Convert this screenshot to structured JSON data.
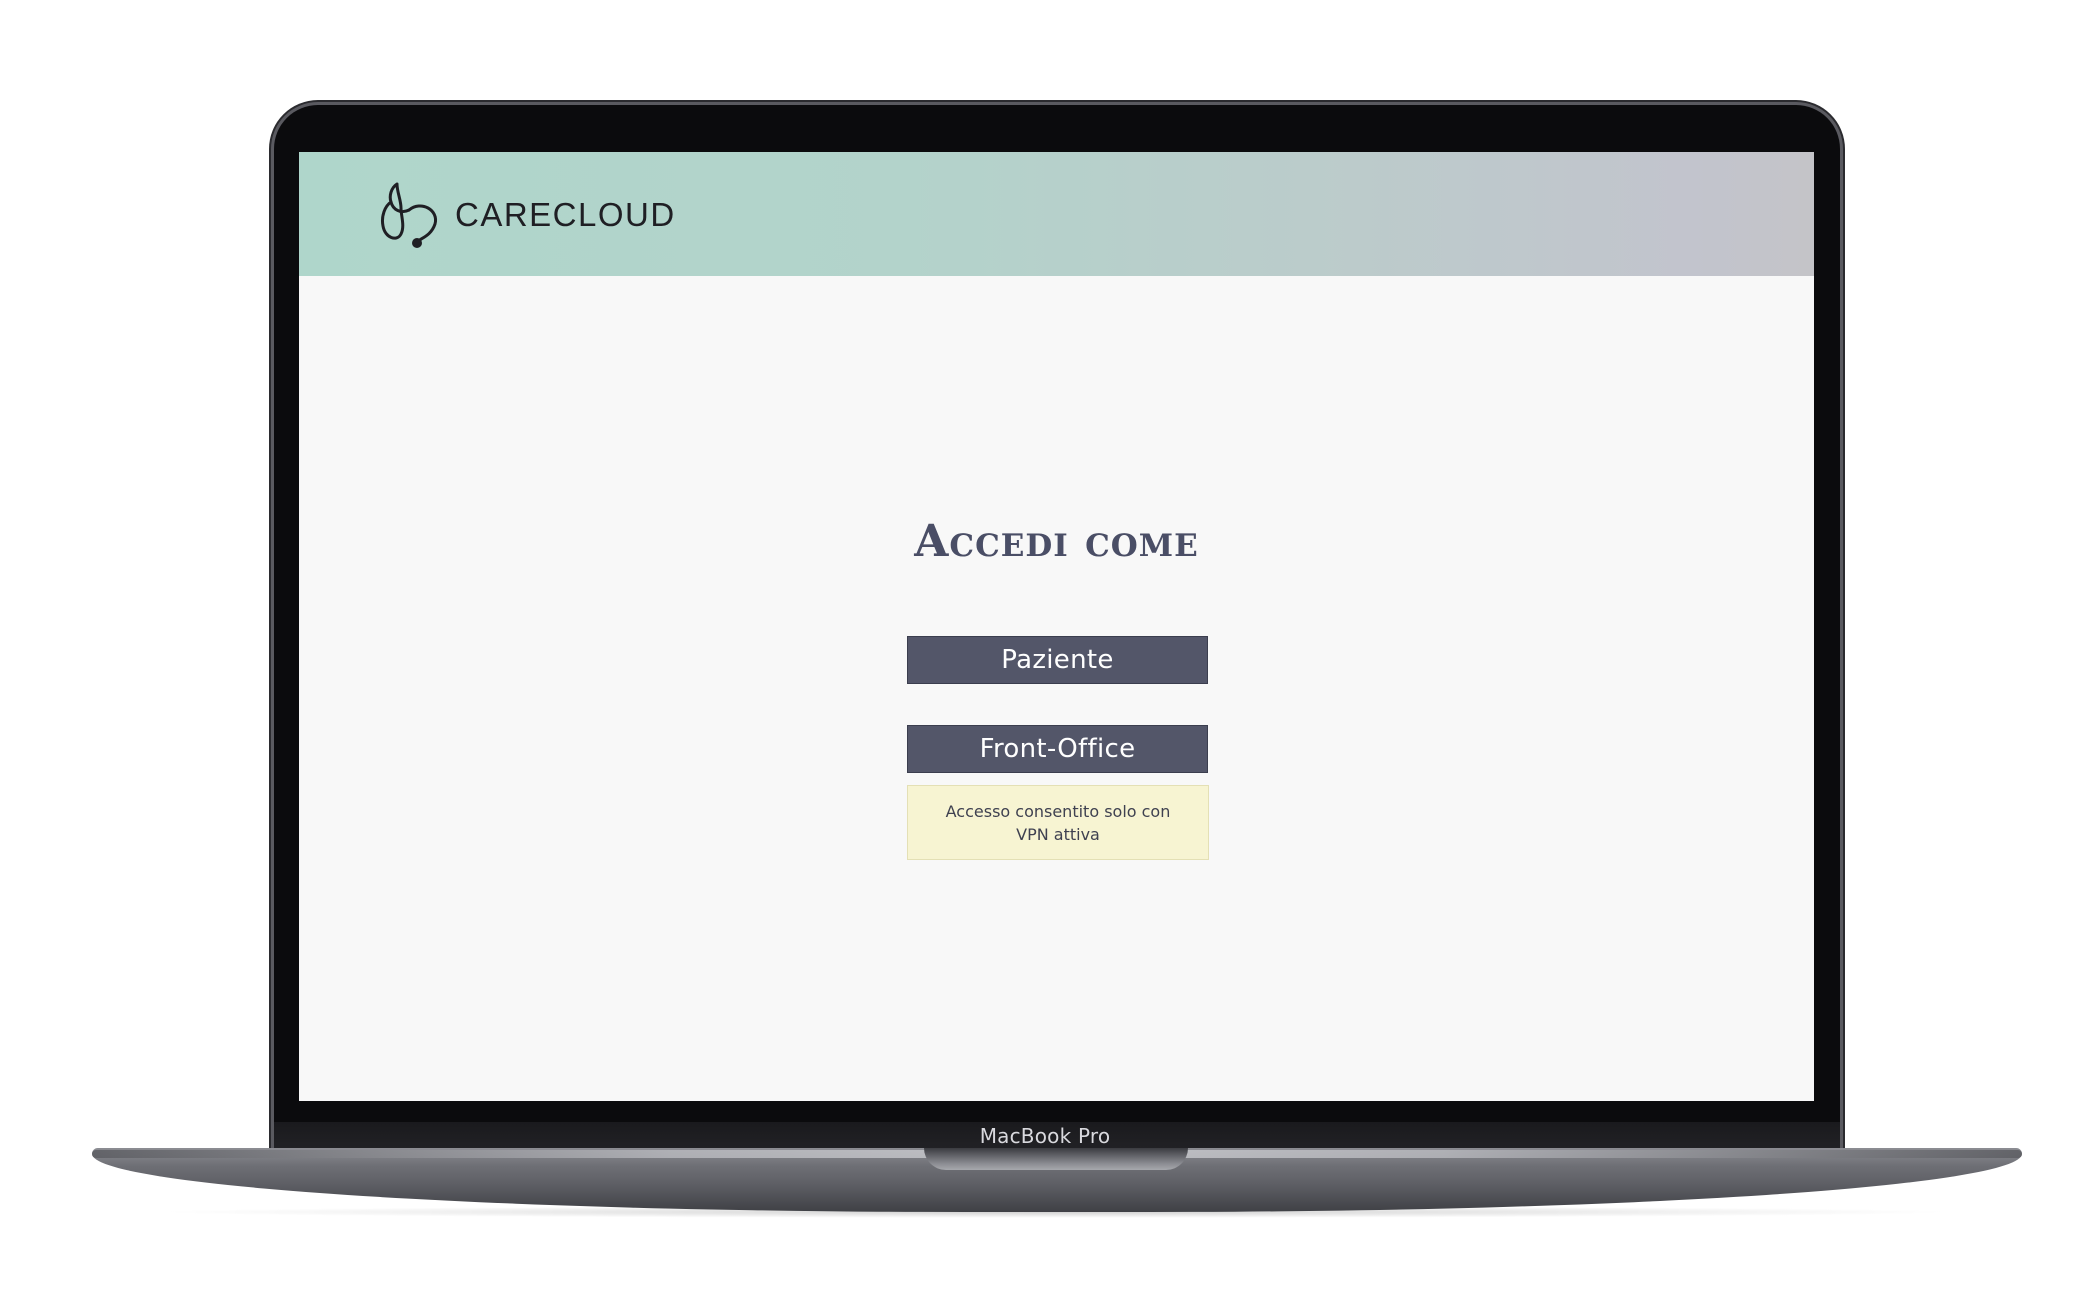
{
  "device": {
    "label": "MacBook Pro"
  },
  "header": {
    "brand_name": "CARECLOUD",
    "logo_icon": "stethoscope-icon"
  },
  "login": {
    "title": "Accedi come",
    "options": [
      {
        "label": "Paziente"
      },
      {
        "label": "Front-Office"
      }
    ],
    "notice": "Accesso consentito solo con VPN attiva"
  },
  "colors": {
    "header_gradient_start": "#afd6cb",
    "header_gradient_end": "#c4c4c8",
    "button_bg": "#535669",
    "title": "#4a4e66",
    "notice_bg": "#f7f4d2",
    "screen_bg": "#f8f8f8"
  }
}
